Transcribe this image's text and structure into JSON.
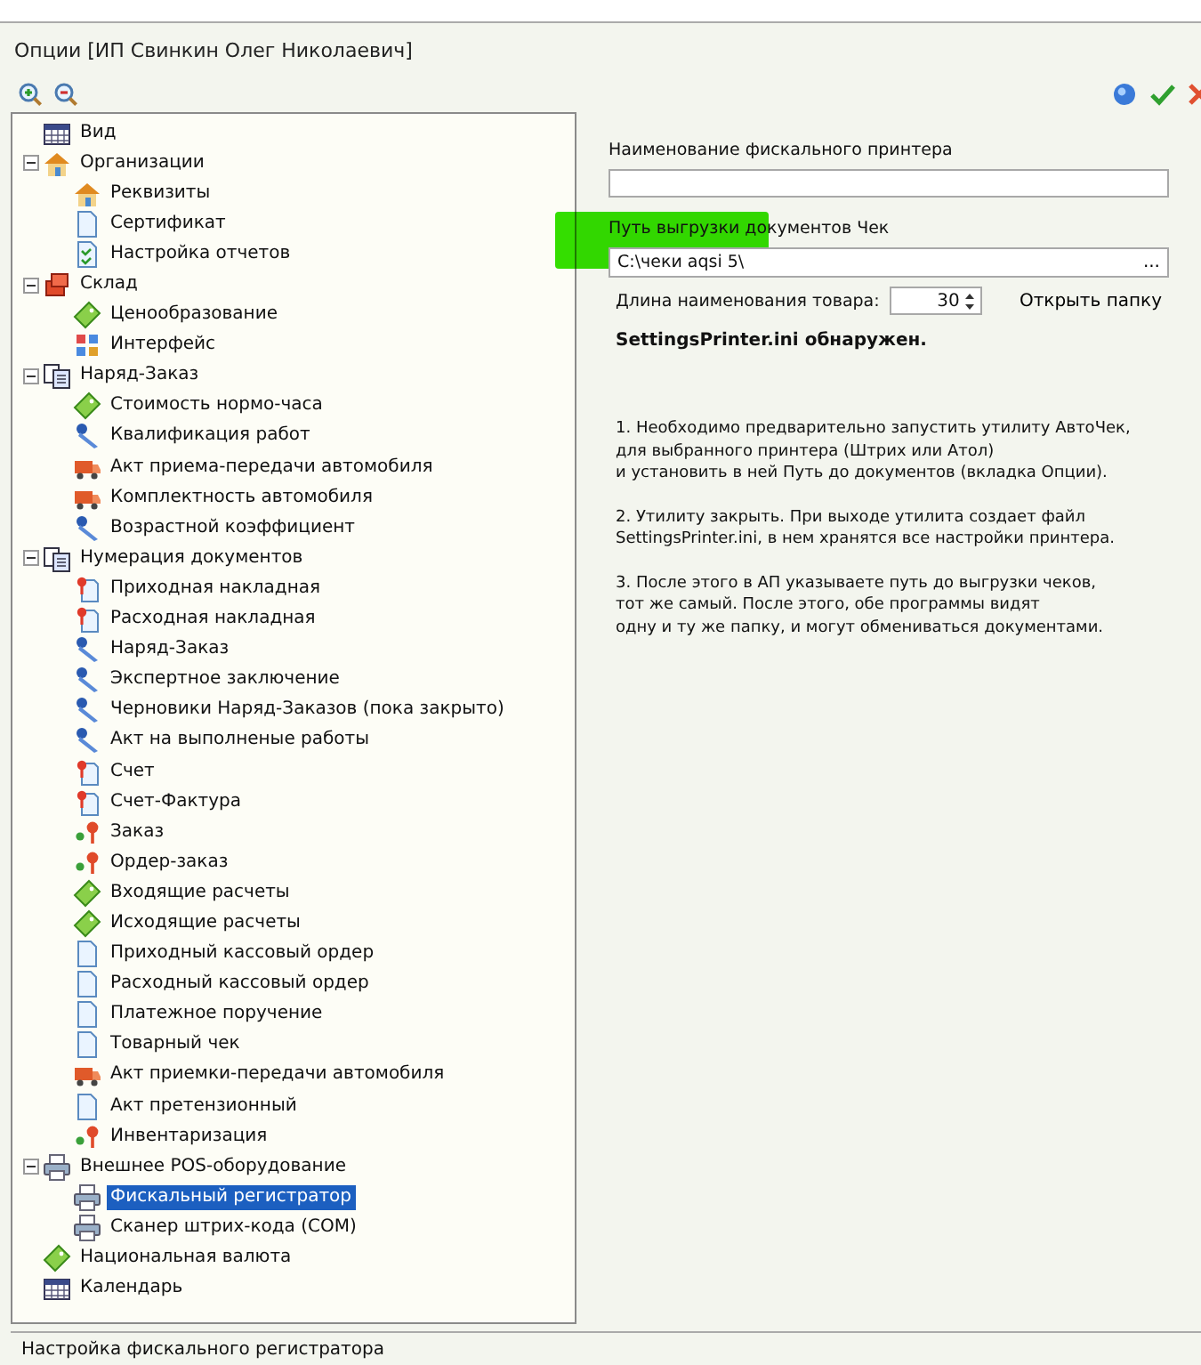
{
  "window": {
    "title": "Опции [ИП Свинкин Олег Николаевич]"
  },
  "tree": [
    {
      "label": "Вид",
      "kind": "grid",
      "selected": false
    },
    {
      "label": "Организации",
      "kind": "house",
      "selected": false,
      "expanded": true,
      "children": [
        {
          "label": "Реквизиты",
          "kind": "house",
          "selected": false
        },
        {
          "label": "Сертификат",
          "kind": "doc",
          "selected": false
        },
        {
          "label": "Настройка отчетов",
          "kind": "checkdoc",
          "selected": false
        }
      ]
    },
    {
      "label": "Склад",
      "kind": "boxes",
      "selected": false,
      "expanded": true,
      "children": [
        {
          "label": "Ценообразование",
          "kind": "tag",
          "selected": false
        },
        {
          "label": "Интерфейс",
          "kind": "blocks",
          "selected": false
        }
      ]
    },
    {
      "label": "Наряд-Заказ",
      "kind": "docs",
      "selected": false,
      "expanded": true,
      "children": [
        {
          "label": "Стоимость нормо-часа",
          "kind": "tag",
          "selected": false
        },
        {
          "label": "Квалификация работ",
          "kind": "tool",
          "selected": false
        },
        {
          "label": "Акт приема-передачи автомобиля",
          "kind": "truck",
          "selected": false
        },
        {
          "label": "Комплектность автомобиля",
          "kind": "truck",
          "selected": false
        },
        {
          "label": "Возрастной коэффициент",
          "kind": "tool",
          "selected": false
        }
      ]
    },
    {
      "label": "Нумерация документов",
      "kind": "docs",
      "selected": false,
      "expanded": true,
      "children": [
        {
          "label": "Приходная накладная",
          "kind": "pindoc",
          "selected": false
        },
        {
          "label": "Расходная накладная",
          "kind": "pindoc",
          "selected": false
        },
        {
          "label": "Наряд-Заказ",
          "kind": "tool",
          "selected": false
        },
        {
          "label": "Экспертное заключение",
          "kind": "tool",
          "selected": false
        },
        {
          "label": "Черновики Наряд-Заказов (пока закрыто)",
          "kind": "tool",
          "selected": false
        },
        {
          "label": "Акт на выполненые работы",
          "kind": "tool",
          "selected": false
        },
        {
          "label": "Счет",
          "kind": "pindoc",
          "selected": false
        },
        {
          "label": "Счет-Фактура",
          "kind": "pindoc",
          "selected": false
        },
        {
          "label": "Заказ",
          "kind": "pin",
          "selected": false
        },
        {
          "label": "Ордер-заказ",
          "kind": "pin",
          "selected": false
        },
        {
          "label": "Входящие расчеты",
          "kind": "tag",
          "selected": false
        },
        {
          "label": "Исходящие расчеты",
          "kind": "tag",
          "selected": false
        },
        {
          "label": "Приходный кассовый ордер",
          "kind": "doc",
          "selected": false
        },
        {
          "label": "Расходный кассовый ордер",
          "kind": "doc",
          "selected": false
        },
        {
          "label": "Платежное поручение",
          "kind": "doc",
          "selected": false
        },
        {
          "label": "Товарный чек",
          "kind": "doc",
          "selected": false
        },
        {
          "label": "Акт приемки-передачи автомобиля",
          "kind": "truck",
          "selected": false
        },
        {
          "label": "Акт претензионный",
          "kind": "doc",
          "selected": false
        },
        {
          "label": "Инвентаризация",
          "kind": "pin",
          "selected": false
        }
      ]
    },
    {
      "label": "Внешнее POS-оборудование",
      "kind": "printer",
      "selected": false,
      "expanded": true,
      "children": [
        {
          "label": "Фискальный регистратор",
          "kind": "printer",
          "selected": true
        },
        {
          "label": "Сканер штрих-кода (COM)",
          "kind": "printer",
          "selected": false
        }
      ]
    },
    {
      "label": "Национальная валюта",
      "kind": "tag",
      "selected": false
    },
    {
      "label": "Календарь",
      "kind": "grid",
      "selected": false
    }
  ],
  "settings": {
    "printer_name": {
      "label": "Наименование фискального принтера"
    },
    "export_path": {
      "label": "Путь выгрузки документов Чек",
      "value": "C:\\чеки aqsi 5\\",
      "browse": "..."
    },
    "name_length": {
      "label": "Длина наименования товара:",
      "value": "30"
    },
    "open_folder": "Открыть папку",
    "status": "SettingsPrinter.ini обнаружен.",
    "instructions": [
      {
        "lines": [
          "1. Необходимо предварительно запустить утилиту АвтоЧек,",
          "для выбранного принтера (Штрих или Атол)",
          "и установить в ней Путь до документов (вкладка Опции)."
        ]
      },
      {
        "lines": [
          "2. Утилиту закрыть. При выходе утилита создает файл",
          "SettingsPrinter.ini, в нем хранятся все настройки принтера."
        ]
      },
      {
        "lines": [
          "3. После этого в АП указываете путь до выгрузки чеков,",
          "тот же самый. После этого, обе программы видят",
          "одну и ту же папку,  и могут обмениваться документами."
        ]
      }
    ]
  },
  "status_bar": "Настройка фискального регистратора"
}
